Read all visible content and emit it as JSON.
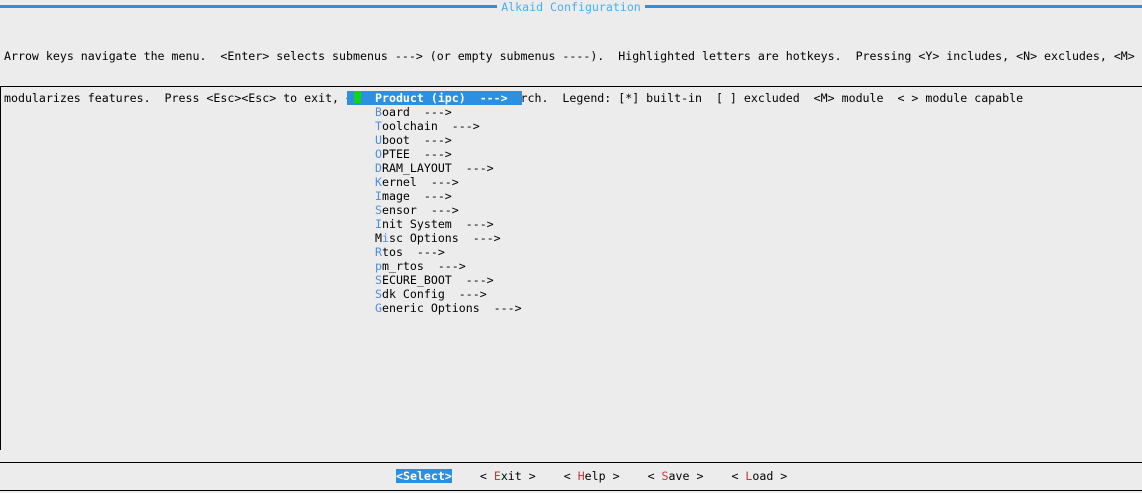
{
  "window": {
    "title": "Alkaid Configuration"
  },
  "help_lines": [
    "Arrow keys navigate the menu.  <Enter> selects submenus ---> (or empty submenus ----).  Highlighted letters are hotkeys.  Pressing <Y> includes, <N> excludes, <M>",
    "modularizes features.  Press <Esc><Esc> to exit, <?> for Help, </> for Search.  Legend: [*] built-in  [ ] excluded  <M> module  < > module capable"
  ],
  "menu": {
    "selected_index": 0,
    "items": [
      {
        "pre": "",
        "hk": "P",
        "post": "roduct (ipc)  --->"
      },
      {
        "pre": "",
        "hk": "B",
        "post": "oard  --->"
      },
      {
        "pre": "",
        "hk": "T",
        "post": "oolchain  --->"
      },
      {
        "pre": "",
        "hk": "U",
        "post": "boot  --->"
      },
      {
        "pre": "",
        "hk": "O",
        "post": "PTEE  --->"
      },
      {
        "pre": "",
        "hk": "D",
        "post": "RAM_LAYOUT  --->"
      },
      {
        "pre": "",
        "hk": "K",
        "post": "ernel  --->"
      },
      {
        "pre": "",
        "hk": "I",
        "post": "mage  --->"
      },
      {
        "pre": "",
        "hk": "S",
        "post": "ensor  --->"
      },
      {
        "pre": "",
        "hk": "I",
        "post": "nit System  --->"
      },
      {
        "pre": "M",
        "hk": "i",
        "post": "sc Options  --->"
      },
      {
        "pre": "",
        "hk": "R",
        "post": "tos  --->"
      },
      {
        "pre": "",
        "hk": "p",
        "post": "m_rtos  --->"
      },
      {
        "pre": "",
        "hk": "S",
        "post": "ECURE_BOOT  --->"
      },
      {
        "pre": "",
        "hk": "S",
        "post": "dk Config  --->"
      },
      {
        "pre": "",
        "hk": "G",
        "post": "eneric Options  --->"
      }
    ]
  },
  "buttons": [
    {
      "name": "select-button",
      "pre": "<",
      "hk": "S",
      "post": "elect>",
      "active": true
    },
    {
      "name": "exit-button",
      "pre": "< ",
      "hk": "E",
      "post": "xit >",
      "active": false
    },
    {
      "name": "help-button",
      "pre": "< ",
      "hk": "H",
      "post": "elp >",
      "active": false
    },
    {
      "name": "save-button",
      "pre": "< ",
      "hk": "S",
      "post": "ave >",
      "active": false
    },
    {
      "name": "load-button",
      "pre": "< ",
      "hk": "L",
      "post": "oad >",
      "active": false
    }
  ],
  "colors": {
    "accent": "#2b8fe2",
    "hotkey_menu": "#4c8fe0",
    "hotkey_button": "#c23a3a",
    "cursor": "#12d612",
    "background": "#ececec"
  }
}
